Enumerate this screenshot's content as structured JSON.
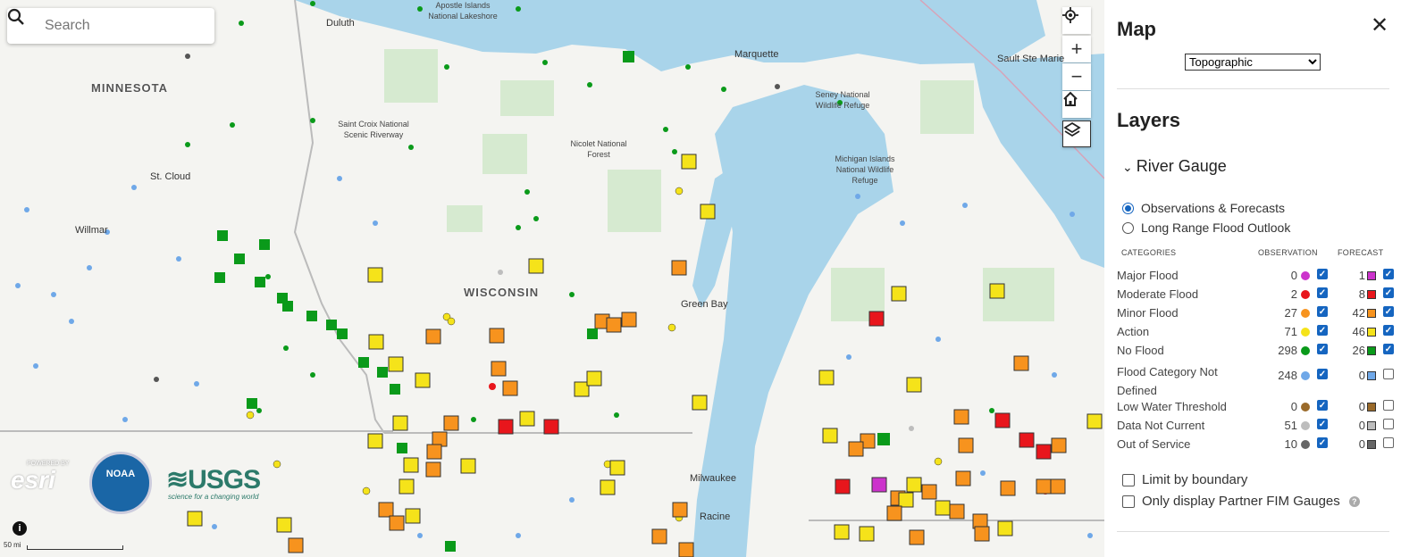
{
  "search": {
    "placeholder": "Search"
  },
  "map_controls": {
    "locate_icon": "crosshair-icon",
    "zoom_in": "+",
    "zoom_out": "−",
    "home_icon": "home-icon",
    "layers_icon": "layers-icon"
  },
  "map_labels": {
    "states": [
      "MINNESOTA",
      "WISCONSIN"
    ],
    "cities": [
      "Duluth",
      "Marquette",
      "Sault Ste Marie",
      "St. Cloud",
      "Willmar",
      "Green Bay",
      "Milwaukee",
      "Racine"
    ],
    "parks": [
      "Apostle Islands National Lakeshore",
      "Saint Croix National Scenic Riverway",
      "Nicolet National Forest",
      "Seney National Wildlife Refuge",
      "Michigan Islands National Wildlife Refuge"
    ]
  },
  "scale_label": "50 mi",
  "info_icon": "i",
  "logos": {
    "esri": "esri",
    "esri_prefix": "POWERED BY",
    "noaa": "NOAA",
    "usgs": "≋USGS",
    "usgs_tagline": "science for a changing world"
  },
  "panel": {
    "title": "Map",
    "close_icon": "✕",
    "basemap": {
      "selected": "Topographic"
    },
    "layers_title": "Layers",
    "river_gauge": {
      "label": "River Gauge",
      "radios": [
        {
          "label": "Observations & Forecasts",
          "selected": true
        },
        {
          "label": "Long Range Flood Outlook",
          "selected": false
        }
      ],
      "headers": {
        "categories": "CATEGORIES",
        "observation": "OBSERVATION",
        "forecast": "FORECAST"
      },
      "categories": [
        {
          "label": "Major Flood",
          "obs_count": "0",
          "obs_color": "#cc33cc",
          "obs_checked": true,
          "fc_count": "1",
          "fc_color": "#cc33cc",
          "fc_checked": true
        },
        {
          "label": "Moderate Flood",
          "obs_count": "2",
          "obs_color": "#e8161c",
          "obs_checked": true,
          "fc_count": "8",
          "fc_color": "#e8161c",
          "fc_checked": true
        },
        {
          "label": "Minor Flood",
          "obs_count": "27",
          "obs_color": "#f7931e",
          "obs_checked": true,
          "fc_count": "42",
          "fc_color": "#f7931e",
          "fc_checked": true
        },
        {
          "label": "Action",
          "obs_count": "71",
          "obs_color": "#f5e31a",
          "obs_checked": true,
          "fc_count": "46",
          "fc_color": "#f5e31a",
          "fc_checked": true
        },
        {
          "label": "No Flood",
          "obs_count": "298",
          "obs_color": "#0a9a1a",
          "obs_checked": true,
          "fc_count": "26",
          "fc_color": "#0a9a1a",
          "fc_checked": true
        },
        {
          "label": "Flood Category Not Defined",
          "obs_count": "248",
          "obs_color": "#6fa8e8",
          "obs_checked": true,
          "fc_count": "0",
          "fc_color": "#6fa8e8",
          "fc_checked": false
        },
        {
          "label": "Low Water Threshold",
          "obs_count": "0",
          "obs_color": "#9a6a2a",
          "obs_checked": true,
          "fc_count": "0",
          "fc_color": "#9a6a2a",
          "fc_checked": false
        },
        {
          "label": "Data Not Current",
          "obs_count": "51",
          "obs_color": "#bdbdbd",
          "obs_checked": true,
          "fc_count": "0",
          "fc_color": "#bdbdbd",
          "fc_checked": false
        },
        {
          "label": "Out of Service",
          "obs_count": "10",
          "obs_color": "#666666",
          "obs_checked": true,
          "fc_count": "0",
          "fc_color": "#666666",
          "fc_checked": false
        }
      ],
      "limit_by_boundary": {
        "label": "Limit by boundary",
        "checked": false
      },
      "partner_fim": {
        "label": "Only display Partner FIM Gauges",
        "checked": false
      }
    }
  }
}
